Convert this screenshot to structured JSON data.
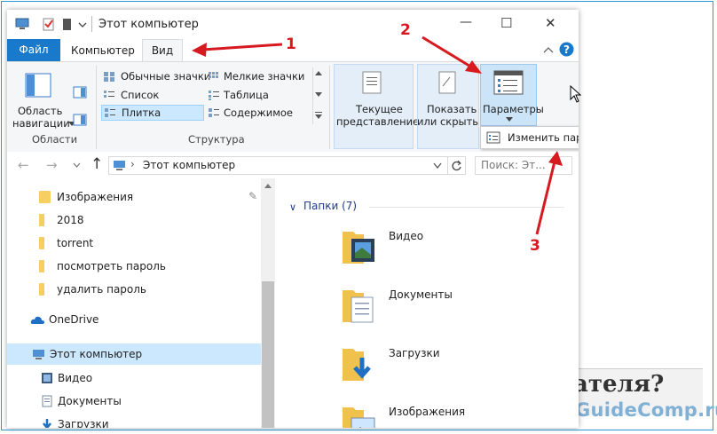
{
  "window": {
    "title": "Этот компьютер",
    "controls": {
      "minimize": "—",
      "maximize": "☐",
      "close": "✕"
    }
  },
  "ribbon_tabs": [
    "Файл",
    "Компьютер",
    "Вид"
  ],
  "ribbon": {
    "nav_pane_label_1": "Область",
    "nav_pane_label_2": "навигации",
    "group_panes": "Области",
    "layout": {
      "items": [
        "Обычные значки",
        "Мелкие значки",
        "Список",
        "Таблица",
        "Плитка",
        "Содержимое"
      ],
      "group": "Структура"
    },
    "current_view_1": "Текущее",
    "current_view_2": "представление",
    "show_hide_1": "Показать",
    "show_hide_2": "или скрыть",
    "options": "Параметры"
  },
  "tooltip": "Изменить параметры папок и поиска",
  "address": {
    "path": "Этот компьютер",
    "search_placeholder": "Поиск: Эт..."
  },
  "nav_items": [
    "Изображения",
    "2018",
    "torrent",
    "посмотреть пароль",
    "удалить пароль",
    "OneDrive",
    "Этот компьютер",
    "Видео",
    "Документы",
    "Загрузки"
  ],
  "content": {
    "section": "Папки (7)",
    "folders": [
      "Видео",
      "Документы",
      "Загрузки",
      "Изображения"
    ]
  },
  "annotations": [
    "1",
    "2",
    "3"
  ],
  "background": {
    "heading": "ателя?",
    "watermark": "GuideComp.ru"
  },
  "colors": {
    "accent": "#1979ca",
    "annotation": "#d71920",
    "selection": "#cce8ff"
  }
}
